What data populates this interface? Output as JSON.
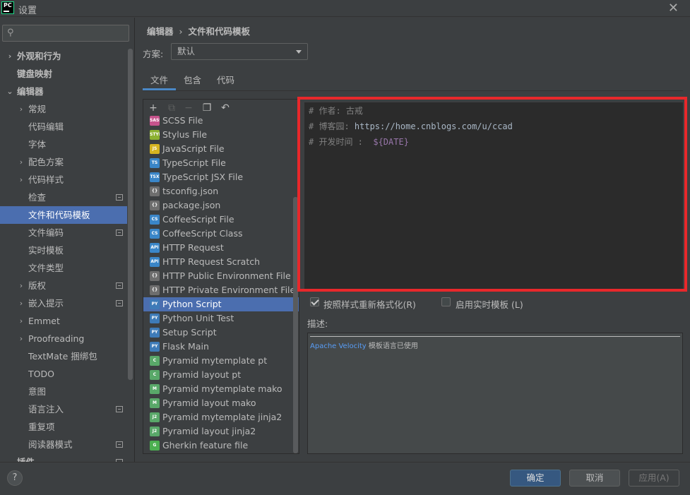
{
  "window": {
    "title": "设置",
    "app_icon_text": "PC"
  },
  "sidebar": {
    "search_placeholder": "",
    "items": [
      {
        "label": "外观和行为",
        "level": 0,
        "expander": "›",
        "bold": true,
        "selected": false,
        "project": false
      },
      {
        "label": "键盘映射",
        "level": 0,
        "expander": "",
        "bold": true,
        "selected": false,
        "project": false
      },
      {
        "label": "编辑器",
        "level": 0,
        "expander": "⌄",
        "bold": true,
        "selected": false,
        "project": false
      },
      {
        "label": "常规",
        "level": 1,
        "expander": "›",
        "bold": false,
        "selected": false,
        "project": false
      },
      {
        "label": "代码编辑",
        "level": 1,
        "expander": "",
        "bold": false,
        "selected": false,
        "project": false
      },
      {
        "label": "字体",
        "level": 1,
        "expander": "",
        "bold": false,
        "selected": false,
        "project": false
      },
      {
        "label": "配色方案",
        "level": 1,
        "expander": "›",
        "bold": false,
        "selected": false,
        "project": false
      },
      {
        "label": "代码样式",
        "level": 1,
        "expander": "›",
        "bold": false,
        "selected": false,
        "project": false
      },
      {
        "label": "检查",
        "level": 1,
        "expander": "",
        "bold": false,
        "selected": false,
        "project": true
      },
      {
        "label": "文件和代码模板",
        "level": 1,
        "expander": "",
        "bold": false,
        "selected": true,
        "project": false
      },
      {
        "label": "文件编码",
        "level": 1,
        "expander": "",
        "bold": false,
        "selected": false,
        "project": true
      },
      {
        "label": "实时模板",
        "level": 1,
        "expander": "",
        "bold": false,
        "selected": false,
        "project": false
      },
      {
        "label": "文件类型",
        "level": 1,
        "expander": "",
        "bold": false,
        "selected": false,
        "project": false
      },
      {
        "label": "版权",
        "level": 1,
        "expander": "›",
        "bold": false,
        "selected": false,
        "project": true
      },
      {
        "label": "嵌入提示",
        "level": 1,
        "expander": "›",
        "bold": false,
        "selected": false,
        "project": true
      },
      {
        "label": "Emmet",
        "level": 1,
        "expander": "›",
        "bold": false,
        "selected": false,
        "project": false
      },
      {
        "label": "Proofreading",
        "level": 1,
        "expander": "›",
        "bold": false,
        "selected": false,
        "project": false
      },
      {
        "label": "TextMate 捆绑包",
        "level": 1,
        "expander": "",
        "bold": false,
        "selected": false,
        "project": false
      },
      {
        "label": "TODO",
        "level": 1,
        "expander": "",
        "bold": false,
        "selected": false,
        "project": false
      },
      {
        "label": "意图",
        "level": 1,
        "expander": "",
        "bold": false,
        "selected": false,
        "project": false
      },
      {
        "label": "语言注入",
        "level": 1,
        "expander": "",
        "bold": false,
        "selected": false,
        "project": true
      },
      {
        "label": "重复项",
        "level": 1,
        "expander": "",
        "bold": false,
        "selected": false,
        "project": false
      },
      {
        "label": "阅读器模式",
        "level": 1,
        "expander": "",
        "bold": false,
        "selected": false,
        "project": true
      },
      {
        "label": "插件",
        "level": 0,
        "expander": "",
        "bold": true,
        "selected": false,
        "project": true
      }
    ]
  },
  "breadcrumb": {
    "parent": "编辑器",
    "separator": "›",
    "current": "文件和代码模板"
  },
  "scheme": {
    "label": "方案:",
    "value": "默认"
  },
  "tabs": [
    {
      "label": "文件",
      "active": true
    },
    {
      "label": "包含",
      "active": false
    },
    {
      "label": "代码",
      "active": false
    }
  ],
  "toolbar": [
    {
      "name": "add-icon",
      "glyph": "+",
      "disabled": false
    },
    {
      "name": "add-child-icon",
      "glyph": "⧉",
      "disabled": true
    },
    {
      "name": "remove-icon",
      "glyph": "−",
      "disabled": true
    },
    {
      "name": "copy-icon",
      "glyph": "❐",
      "disabled": false
    },
    {
      "name": "reset-icon",
      "glyph": "↶",
      "disabled": false
    }
  ],
  "templates": [
    {
      "label": "SCSS File",
      "icon": "SASS",
      "color": "#c6538c",
      "selected": false
    },
    {
      "label": "Stylus File",
      "icon": "STYL",
      "color": "#8cb131",
      "selected": false
    },
    {
      "label": "JavaScript File",
      "icon": "JS",
      "color": "#d6b420",
      "selected": false
    },
    {
      "label": "TypeScript File",
      "icon": "TS",
      "color": "#3a86c8",
      "selected": false
    },
    {
      "label": "TypeScript JSX File",
      "icon": "TSX",
      "color": "#3a86c8",
      "selected": false
    },
    {
      "label": "tsconfig.json",
      "icon": "{}",
      "color": "#6e6e6e",
      "selected": false
    },
    {
      "label": "package.json",
      "icon": "{}",
      "color": "#6e6e6e",
      "selected": false
    },
    {
      "label": "CoffeeScript File",
      "icon": "CS",
      "color": "#3a86c8",
      "selected": false
    },
    {
      "label": "CoffeeScript Class",
      "icon": "CS",
      "color": "#3a86c8",
      "selected": false
    },
    {
      "label": "HTTP Request",
      "icon": "API",
      "color": "#3a86c8",
      "selected": false
    },
    {
      "label": "HTTP Request Scratch",
      "icon": "API",
      "color": "#3a86c8",
      "selected": false
    },
    {
      "label": "HTTP Public Environment File",
      "icon": "{}",
      "color": "#6e6e6e",
      "selected": false
    },
    {
      "label": "HTTP Private Environment File",
      "icon": "{}",
      "color": "#6e6e6e",
      "selected": false
    },
    {
      "label": "Python Script",
      "icon": "PY",
      "color": "#3e7bb8",
      "selected": true
    },
    {
      "label": "Python Unit Test",
      "icon": "PY",
      "color": "#3e7bb8",
      "selected": false
    },
    {
      "label": "Setup Script",
      "icon": "PY",
      "color": "#3e7bb8",
      "selected": false
    },
    {
      "label": "Flask Main",
      "icon": "PY",
      "color": "#3e7bb8",
      "selected": false
    },
    {
      "label": "Pyramid mytemplate pt",
      "icon": "C",
      "color": "#59a869",
      "selected": false
    },
    {
      "label": "Pyramid layout pt",
      "icon": "C",
      "color": "#59a869",
      "selected": false
    },
    {
      "label": "Pyramid mytemplate mako",
      "icon": "M",
      "color": "#59a869",
      "selected": false
    },
    {
      "label": "Pyramid layout mako",
      "icon": "M",
      "color": "#59a869",
      "selected": false
    },
    {
      "label": "Pyramid mytemplate jinja2",
      "icon": "J2",
      "color": "#59a869",
      "selected": false
    },
    {
      "label": "Pyramid layout jinja2",
      "icon": "J2",
      "color": "#59a869",
      "selected": false
    },
    {
      "label": "Gherkin feature file",
      "icon": "G",
      "color": "#4caf50",
      "selected": false
    }
  ],
  "editor": {
    "line1": {
      "text": "# 作者: 古戒"
    },
    "line2": {
      "prefix": "# 博客园: ",
      "url": "https://home.cnblogs.com/u/ccad"
    },
    "line3": {
      "prefix": "# 开发时间 :  ",
      "var": "${DATE}"
    }
  },
  "options": {
    "reformat": {
      "label": "按照样式重新格式化(R)",
      "checked": true
    },
    "live_template": {
      "label": "启用实时模板 (L)",
      "checked": false
    }
  },
  "description": {
    "label": "描述:",
    "link": "Apache Velocity",
    "text": " 模板语言已使用"
  },
  "footer": {
    "help": "?",
    "ok": "确定",
    "cancel": "取消",
    "apply": "应用(A)"
  },
  "colors": {
    "accent": "#4b6eaf",
    "highlight_border": "#e8282b",
    "editor_bg": "#2b2b2b",
    "primary_button": "#365880"
  }
}
